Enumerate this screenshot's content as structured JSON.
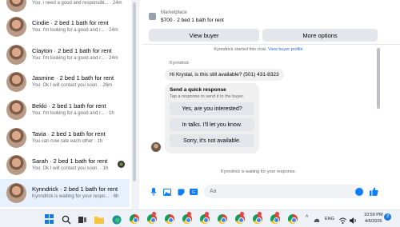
{
  "sidebar": {
    "conversations": [
      {
        "name": "",
        "preview": "You: i need a good and responsibl... · 24m"
      },
      {
        "name": "Cindie · 2 bed 1 bath for rent",
        "preview": "You: I'm looking for a good and r... · 24m"
      },
      {
        "name": "Clayton · 2 bed 1 bath for rent",
        "preview": "You: I'm looking for a good and r... · 24m"
      },
      {
        "name": "Jasmine · 2 bed 1 bath for rent",
        "preview": "You: Ok I will contact you soon. · 26m"
      },
      {
        "name": "Bekki · 2 bed 1 bath for rent",
        "preview": "You: I'm looking for a good and r... · 1h"
      },
      {
        "name": "Tavia · 2 bed 1 bath for rent",
        "preview": "You can now rate each other · 1h"
      },
      {
        "name": "Sarah · 2 bed 1 bath for rent",
        "preview": "You: Ok I will contact you soon. · 1h"
      },
      {
        "name": "Kynndrick · 2 bed 1 bath for rent",
        "preview": "Kynndrick is waiting for your respo... · 6h"
      }
    ]
  },
  "chat": {
    "listing_label": "Marketplace",
    "listing_title": "$700 · 2 bed 1 bath for rent",
    "view_buyer": "View buyer",
    "more_options": "More options",
    "started_text": "Kynndrick started this chat.",
    "view_profile": "View buyer profile",
    "sender": "Kynndrick",
    "message": "Hi Krystal, is this still available? (501) 431-8323",
    "quick_title": "Send a quick response",
    "quick_sub": "Tap a response to send it to the buyer.",
    "quick_replies": [
      "Yes, are you interested?",
      "In talks. I'll let you know.",
      "Sorry, it's not available."
    ],
    "waiting": "Kynndrick is waiting for your response.",
    "input_placeholder": "Aa"
  },
  "taskbar": {
    "language": "ENG",
    "time": "10:59 PM",
    "date": "4/6/2026",
    "notifications": "3"
  }
}
